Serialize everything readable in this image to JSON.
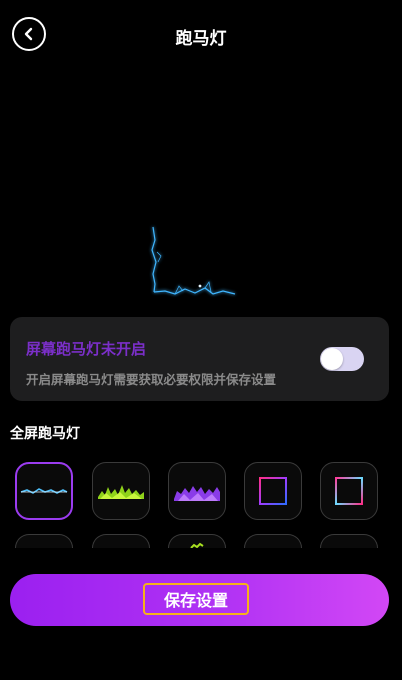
{
  "header": {
    "title": "跑马灯",
    "back_icon": "chevron-left-icon"
  },
  "notice": {
    "title": "屏幕跑马灯未开启",
    "description": "开启屏幕跑马灯需要获取必要权限并保存设置",
    "toggle_on": false,
    "title_color": "#7b2fc9"
  },
  "section": {
    "title": "全屏跑马灯"
  },
  "styles": [
    {
      "name": "blue-lightning",
      "selected": true
    },
    {
      "name": "green-flame",
      "selected": false
    },
    {
      "name": "purple-flame",
      "selected": false
    },
    {
      "name": "pink-blue-frame",
      "selected": false
    },
    {
      "name": "pink-cyan-frame",
      "selected": false
    }
  ],
  "save_button": {
    "label": "保存设置",
    "gradient": [
      "#9b20f0",
      "#d247f5"
    ],
    "highlight_color": "#f6b21a"
  }
}
